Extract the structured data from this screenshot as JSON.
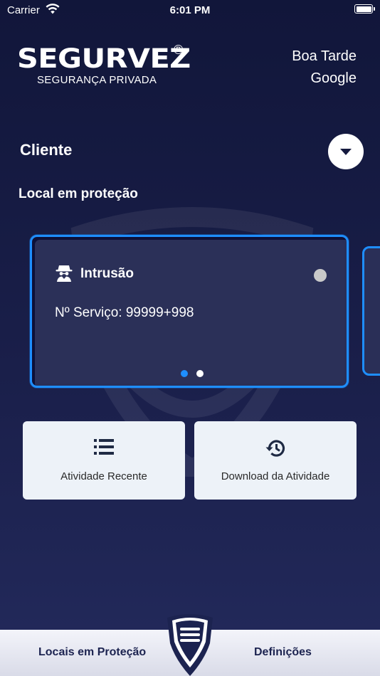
{
  "status_bar": {
    "carrier": "Carrier",
    "time": "6:01 PM"
  },
  "brand": {
    "name": "SEGURVEZ",
    "registered": "®",
    "tagline": "SEGURANÇA PRIVADA"
  },
  "greeting": {
    "line1": "Boa Tarde",
    "line2": "Google"
  },
  "client": {
    "label": "Cliente",
    "toggle_icon": "chevron-down-icon"
  },
  "section": {
    "title": "Local em proteção"
  },
  "card": {
    "icon": "spy-icon",
    "title": "Intrusão",
    "service": "Nº Serviço: 99999+998",
    "status_color": "#c9c9c9",
    "page_count": 2,
    "active_page": 1
  },
  "actions": {
    "recent": {
      "icon": "list-icon",
      "label": "Atividade Recente"
    },
    "download": {
      "icon": "history-icon",
      "label": "Download da Atividade"
    }
  },
  "tabbar": {
    "left_label": "Locais em Proteção",
    "right_label": "Definições",
    "center_icon": "menu-shield-icon"
  },
  "colors": {
    "accent": "#1e8eff",
    "background": "#151a3f",
    "tab_text": "#1c2350"
  }
}
